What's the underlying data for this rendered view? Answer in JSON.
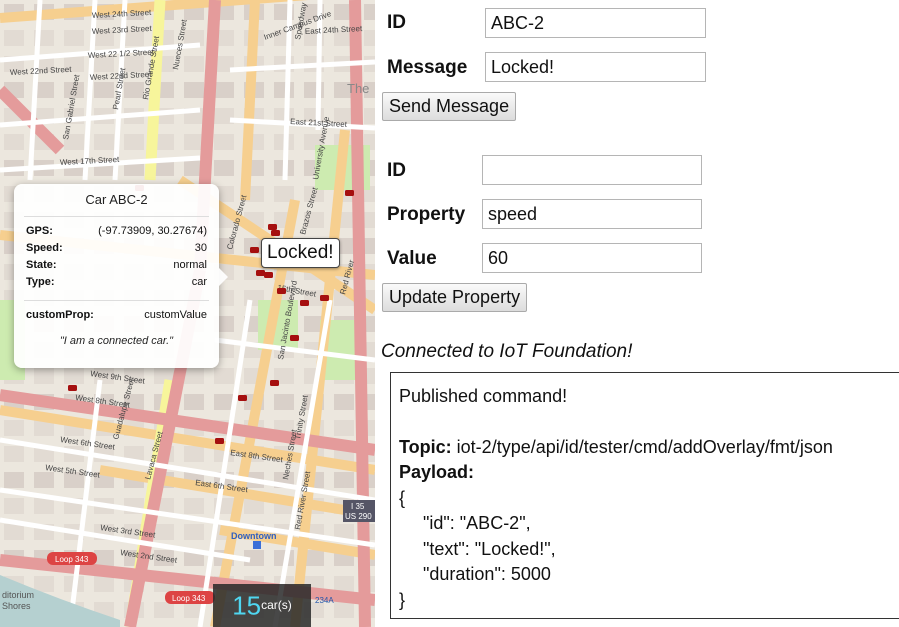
{
  "map": {
    "popup": {
      "title": "Car ABC-2",
      "rows": [
        {
          "label": "GPS:",
          "value": "(-97.73909, 30.27674)"
        },
        {
          "label": "Speed:",
          "value": "30"
        },
        {
          "label": "State:",
          "value": "normal"
        },
        {
          "label": "Type:",
          "value": "car"
        }
      ],
      "custom": {
        "label": "customProp:",
        "value": "customValue"
      },
      "quote": "\"I am a connected car.\""
    },
    "overlay_text": "Locked!",
    "car_count": "15",
    "car_count_unit": "car(s)",
    "street_labels": [
      "West 24th Street",
      "West 23rd Street",
      "West 22 1/2 Street",
      "West 22nd Street",
      "West 22nd Street",
      "West 17th Street",
      "West 8th Street",
      "West 6th Street",
      "West 5th Street",
      "West 3rd Street",
      "West 2nd Street",
      "East 24th Street",
      "East 21st Street",
      "15th Street",
      "East 8th Street",
      "East 6th Street",
      "Nueces Street",
      "Rio Grande Street",
      "Guadalupe Street",
      "Lavaca Street",
      "Colorado Street",
      "Brazos Street",
      "San Jacinto Boulevard",
      "Trinity Street",
      "Neches Street",
      "Red River Street",
      "University Avenue",
      "Speedway",
      "Inner Campus Drive",
      "Pearl Street",
      "San Gabriel Street",
      "Downtown",
      "West 9th Street",
      "Red River"
    ],
    "shields": [
      "Loop 343",
      "Loop 343",
      "I 35",
      "US 290",
      "234A"
    ],
    "poi_labels": [
      "The",
      "ditorium",
      "Shores"
    ]
  },
  "send_form": {
    "id_label": "ID",
    "id_value": "ABC-2",
    "message_label": "Message",
    "message_value": "Locked!",
    "button": "Send Message"
  },
  "property_form": {
    "id_label": "ID",
    "id_value": "",
    "property_label": "Property",
    "property_value": "speed",
    "value_label": "Value",
    "value_value": "60",
    "button": "Update Property"
  },
  "status": "Connected to IoT Foundation!",
  "log": {
    "line1": "Published command!",
    "topic_label": "Topic:",
    "topic_value": "iot-2/type/api/id/tester/cmd/addOverlay/fmt/json",
    "payload_label": "Payload:",
    "payload_lines": [
      "{",
      "\"id\": \"ABC-2\",",
      "\"text\": \"Locked!\",",
      "\"duration\": 5000",
      "}"
    ]
  },
  "colors": {
    "map_background": "#ece7de",
    "major_road": "#e49b9b",
    "secondary_road": "#f6cf8f",
    "yellow_road": "#f7f59b",
    "park": "#cdebb0",
    "car_marker": "#a50f0f",
    "counter_accent": "#4fd6f0"
  }
}
